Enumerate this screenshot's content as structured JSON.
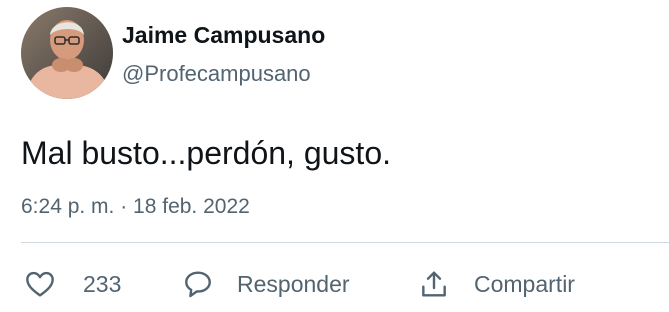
{
  "author": {
    "name": "Jaime Campusano",
    "handle": "@Profecampusano"
  },
  "tweet": {
    "text": "Mal busto...perdón, gusto.",
    "timestamp": "6:24 p. m. · 18 feb. 2022"
  },
  "actions": {
    "like_count": "233",
    "reply_label": "Responder",
    "share_label": "Compartir"
  },
  "icons": {
    "like": "heart-outline-icon",
    "reply": "speech-bubble-icon",
    "share": "share-upload-icon"
  },
  "colors": {
    "text_primary": "#0f1419",
    "text_secondary": "#536471",
    "divider": "#cfd9de",
    "background": "#ffffff"
  }
}
